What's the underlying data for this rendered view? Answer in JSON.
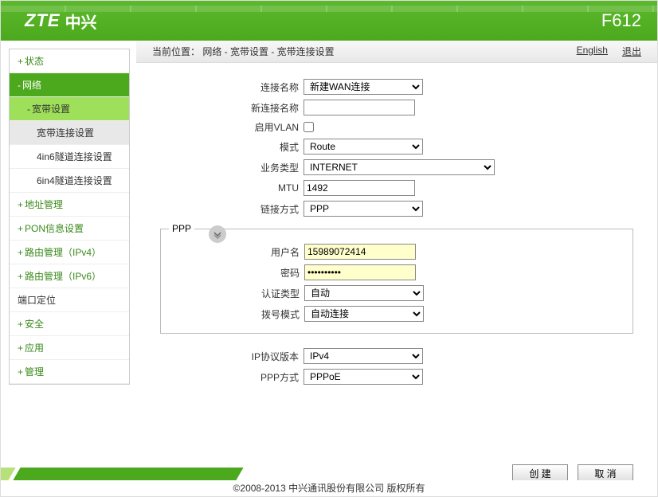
{
  "header": {
    "brand_en": "ZTE",
    "brand_cn": "中兴",
    "model": "F612"
  },
  "sidebar": {
    "status": "状态",
    "network": "网络",
    "broadband": "宽带设置",
    "bb_conn": "宽带连接设置",
    "tun_4in6": "4in6隧道连接设置",
    "tun_6in4": "6in4隧道连接设置",
    "addr_mgmt": "地址管理",
    "pon": "PON信息设置",
    "route_v4": "路由管理（IPv4）",
    "route_v6": "路由管理（IPv6）",
    "port_locate": "端口定位",
    "security": "安全",
    "app": "应用",
    "mgmt": "管理"
  },
  "topbar": {
    "breadcrumb": "当前位置： 网络 - 宽带设置 - 宽带连接设置",
    "lang": "English",
    "logout": "退出"
  },
  "form": {
    "conn_name": {
      "label": "连接名称",
      "value": "新建WAN连接"
    },
    "new_conn": {
      "label": "新连接名称",
      "value": ""
    },
    "vlan": {
      "label": "启用VLAN",
      "checked": false
    },
    "mode": {
      "label": "模式",
      "value": "Route"
    },
    "service": {
      "label": "业务类型",
      "value": "INTERNET"
    },
    "mtu": {
      "label": "MTU",
      "value": "1492"
    },
    "link": {
      "label": "链接方式",
      "value": "PPP"
    },
    "ppp": {
      "legend": "PPP",
      "user": {
        "label": "用户名",
        "value": "15989072414"
      },
      "pass": {
        "label": "密码",
        "value": "••••••••••"
      },
      "auth": {
        "label": "认证类型",
        "value": "自动"
      },
      "dial": {
        "label": "拨号模式",
        "value": "自动连接"
      }
    },
    "ipver": {
      "label": "IP协议版本",
      "value": "IPv4"
    },
    "pppmode": {
      "label": "PPP方式",
      "value": "PPPoE"
    }
  },
  "footer": {
    "create": "创 建",
    "cancel": "取 消",
    "copyright": "©2008-2013 中兴通讯股份有限公司 版权所有"
  }
}
